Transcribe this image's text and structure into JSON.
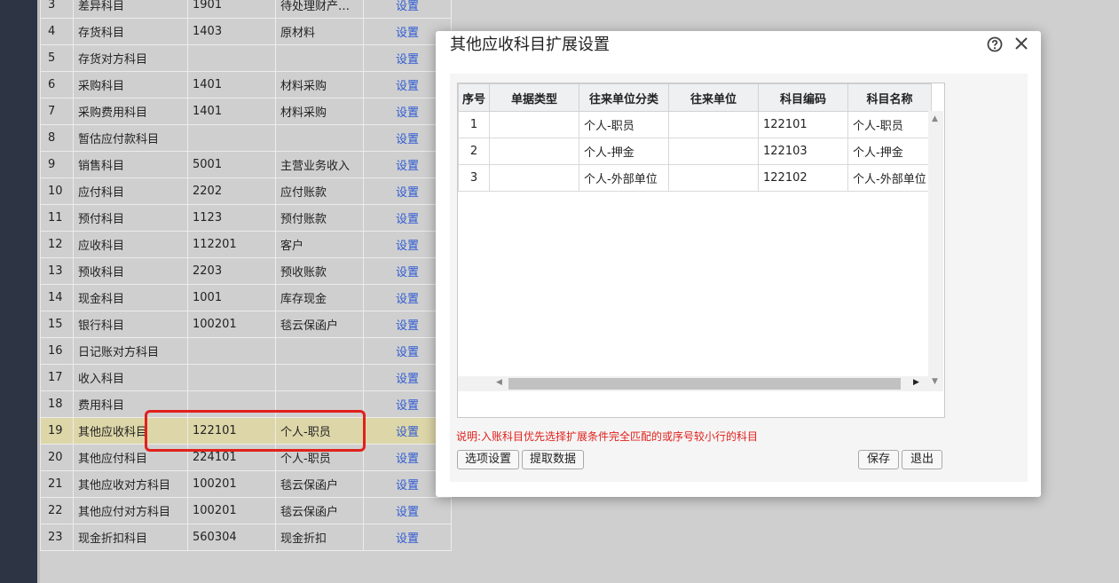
{
  "background_table": {
    "rows": [
      {
        "no": "3",
        "name": "差异科目",
        "code": "1901",
        "account": "待处理财产…",
        "action": "设置"
      },
      {
        "no": "4",
        "name": "存货科目",
        "code": "1403",
        "account": "原材料",
        "action": "设置"
      },
      {
        "no": "5",
        "name": "存货对方科目",
        "code": "",
        "account": "",
        "action": "设置"
      },
      {
        "no": "6",
        "name": "采购科目",
        "code": "1401",
        "account": "材料采购",
        "action": "设置"
      },
      {
        "no": "7",
        "name": "采购费用科目",
        "code": "1401",
        "account": "材料采购",
        "action": "设置"
      },
      {
        "no": "8",
        "name": "暂估应付款科目",
        "code": "",
        "account": "",
        "action": "设置"
      },
      {
        "no": "9",
        "name": "销售科目",
        "code": "5001",
        "account": "主营业务收入",
        "action": "设置"
      },
      {
        "no": "10",
        "name": "应付科目",
        "code": "2202",
        "account": "应付账款",
        "action": "设置"
      },
      {
        "no": "11",
        "name": "预付科目",
        "code": "1123",
        "account": "预付账款",
        "action": "设置"
      },
      {
        "no": "12",
        "name": "应收科目",
        "code": "112201",
        "account": "客户",
        "action": "设置"
      },
      {
        "no": "13",
        "name": "预收科目",
        "code": "2203",
        "account": "预收账款",
        "action": "设置"
      },
      {
        "no": "14",
        "name": "现金科目",
        "code": "1001",
        "account": "库存现金",
        "action": "设置"
      },
      {
        "no": "15",
        "name": "银行科目",
        "code": "100201",
        "account": "毯云保函户",
        "action": "设置"
      },
      {
        "no": "16",
        "name": "日记账对方科目",
        "code": "",
        "account": "",
        "action": "设置"
      },
      {
        "no": "17",
        "name": "收入科目",
        "code": "",
        "account": "",
        "action": "设置"
      },
      {
        "no": "18",
        "name": "费用科目",
        "code": "",
        "account": "",
        "action": "设置"
      },
      {
        "no": "19",
        "name": "其他应收科目",
        "code": "122101",
        "account": "个人-职员",
        "action": "设置"
      },
      {
        "no": "20",
        "name": "其他应付科目",
        "code": "224101",
        "account": "个人-职员",
        "action": "设置"
      },
      {
        "no": "21",
        "name": "其他应收对方科目",
        "code": "100201",
        "account": "毯云保函户",
        "action": "设置"
      },
      {
        "no": "22",
        "name": "其他应付对方科目",
        "code": "100201",
        "account": "毯云保函户",
        "action": "设置"
      },
      {
        "no": "23",
        "name": "现金折扣科目",
        "code": "560304",
        "account": "现金折扣",
        "action": "设置"
      }
    ]
  },
  "dialog": {
    "title": "其他应收科目扩展设置",
    "help_icon": "question-circle-icon",
    "close_icon": "close-icon",
    "grid": {
      "columns": [
        "序号",
        "单据类型",
        "往来单位分类",
        "往来单位",
        "科目编码",
        "科目名称"
      ],
      "rows": [
        {
          "idx": "1",
          "doc_type": "",
          "category": "个人-职员",
          "unit": "",
          "code": "122101",
          "name": "个人-职员"
        },
        {
          "idx": "2",
          "doc_type": "",
          "category": "个人-押金",
          "unit": "",
          "code": "122103",
          "name": "个人-押金"
        },
        {
          "idx": "3",
          "doc_type": "",
          "category": "个人-外部单位",
          "unit": "",
          "code": "122102",
          "name": "个人-外部单位"
        }
      ]
    },
    "note": "说明:入账科目优先选择扩展条件完全匹配的或序号较小行的科目",
    "buttons": {
      "options": "选项设置",
      "fetch": "提取数据",
      "save": "保存",
      "exit": "退出"
    }
  },
  "colors": {
    "link": "#2f5bd2",
    "note": "#e0211c",
    "highlight": "#e0211c",
    "selected_row": "#ddd6a8",
    "sidebar": "#2d3444"
  }
}
